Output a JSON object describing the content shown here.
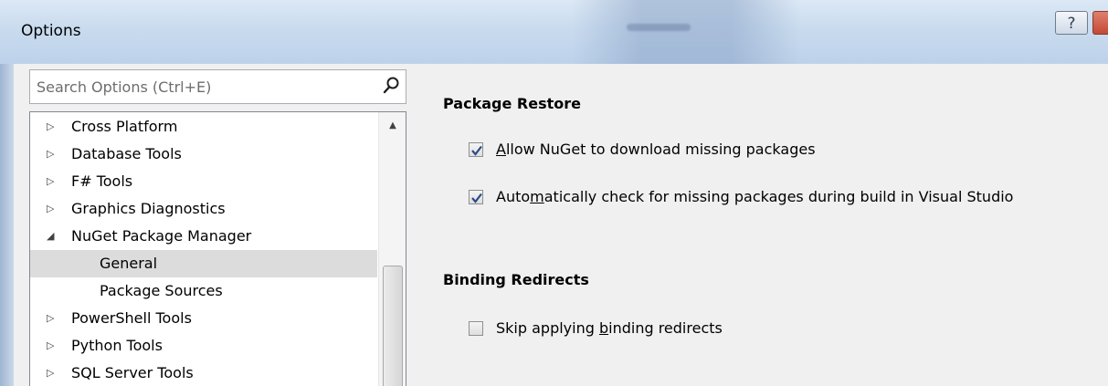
{
  "window": {
    "title": "Options",
    "help_label": "?"
  },
  "search": {
    "placeholder": "Search Options (Ctrl+E)"
  },
  "tree": {
    "items": [
      {
        "label": "Cross Platform",
        "arrow": "▷",
        "level": 0
      },
      {
        "label": "Database Tools",
        "arrow": "▷",
        "level": 0
      },
      {
        "label": "F# Tools",
        "arrow": "▷",
        "level": 0
      },
      {
        "label": "Graphics Diagnostics",
        "arrow": "▷",
        "level": 0
      },
      {
        "label": "NuGet Package Manager",
        "arrow": "◢",
        "level": 0
      },
      {
        "label": "General",
        "arrow": "",
        "level": 1,
        "selected": true
      },
      {
        "label": "Package Sources",
        "arrow": "",
        "level": 1
      },
      {
        "label": "PowerShell Tools",
        "arrow": "▷",
        "level": 0
      },
      {
        "label": "Python Tools",
        "arrow": "▷",
        "level": 0
      },
      {
        "label": "SQL Server Tools",
        "arrow": "▷",
        "level": 0
      }
    ]
  },
  "package_restore": {
    "header": "Package Restore",
    "allow_download": {
      "label_pre": "",
      "label_accel": "A",
      "label_post": "llow NuGet to download missing packages",
      "checked": true
    },
    "auto_check": {
      "label_pre": "Auto",
      "label_accel": "m",
      "label_post": "atically check for missing packages during build in Visual Studio",
      "checked": true
    }
  },
  "binding_redirects": {
    "header": "Binding Redirects",
    "skip": {
      "label_pre": "Skip applying ",
      "label_accel": "b",
      "label_post": "inding redirects",
      "checked": false
    }
  },
  "colors": {
    "checkmark": "#2a4a8a",
    "selection": "#dcdcdc"
  }
}
